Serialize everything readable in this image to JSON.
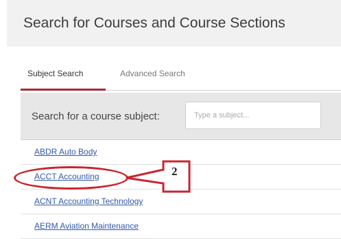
{
  "header": {
    "title": "Search for Courses and Course Sections"
  },
  "tabs": [
    {
      "label": "Subject Search",
      "active": true
    },
    {
      "label": "Advanced Search",
      "active": false
    }
  ],
  "search": {
    "label": "Search for a course subject:",
    "placeholder": "Type a subject...",
    "value": ""
  },
  "subjects": [
    {
      "label": "ABDR Auto Body"
    },
    {
      "label": "ACCT Accounting"
    },
    {
      "label": "ACNT Accounting Technology"
    },
    {
      "label": "AERM Aviation Maintenance"
    }
  ],
  "annotation": {
    "number": "2",
    "target": "ACCT Accounting",
    "color": "#c9252f"
  },
  "colors": {
    "accent": "#a52a3a",
    "link": "#2f59a8",
    "annotation": "#c9252f"
  }
}
